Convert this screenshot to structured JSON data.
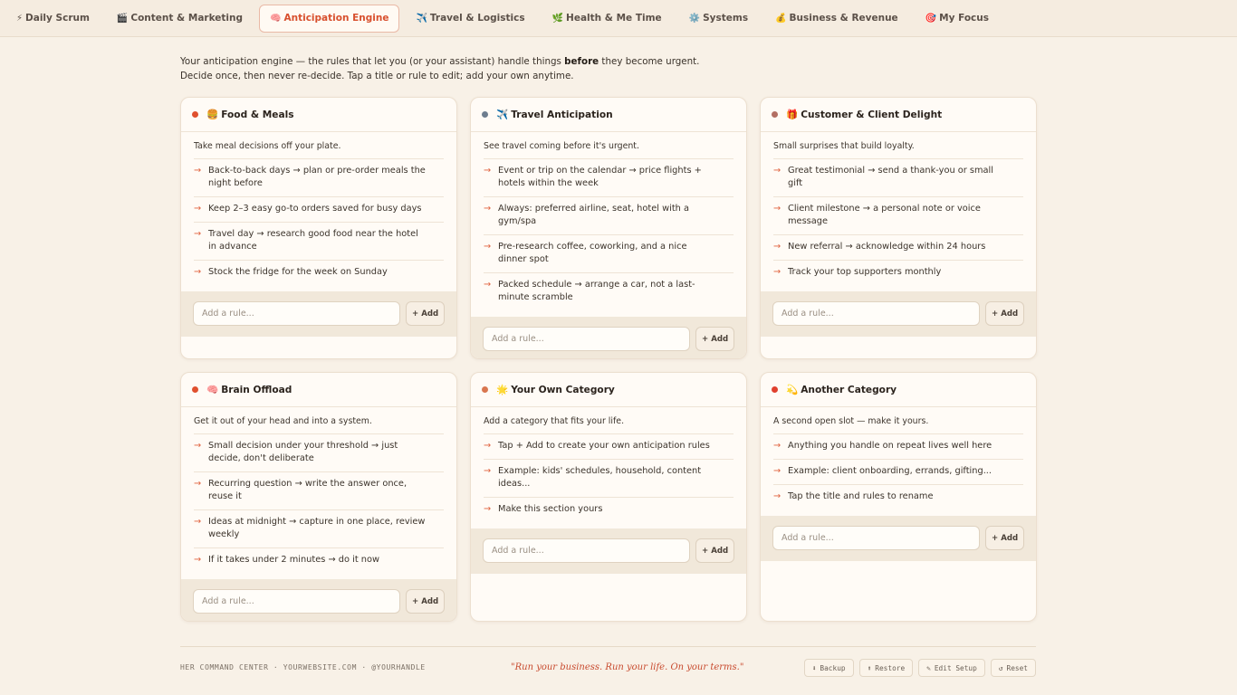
{
  "nav": {
    "tabs": [
      {
        "icon": "⚡",
        "label": "Daily Scrum"
      },
      {
        "icon": "🎬",
        "label": "Content & Marketing"
      },
      {
        "icon": "🧠",
        "label": "Anticipation Engine"
      },
      {
        "icon": "✈️",
        "label": "Travel & Logistics"
      },
      {
        "icon": "🌿",
        "label": "Health & Me Time"
      },
      {
        "icon": "⚙️",
        "label": "Systems"
      },
      {
        "icon": "💰",
        "label": "Business & Revenue"
      },
      {
        "icon": "🎯",
        "label": "My Focus"
      }
    ],
    "active_index": 2
  },
  "intro": {
    "part1": "Your anticipation engine — the rules that let you (or your assistant) handle things ",
    "bold": "before",
    "part2": " they become urgent. Decide once, then never re-decide. Tap a title or rule to edit; add your own anytime."
  },
  "cards": [
    {
      "dot_color": "#e0502e",
      "icon": "🍔",
      "title": "Food & Meals",
      "desc": "Take meal decisions off your plate.",
      "rules": [
        "Back-to-back days → plan or pre-order meals the night before",
        "Keep 2–3 easy go-to orders saved for busy days",
        "Travel day → research good food near the hotel in advance",
        "Stock the fridge for the week on Sunday"
      ],
      "placeholder": "Add a rule...",
      "add_label": "+ Add"
    },
    {
      "dot_color": "#6d7d8f",
      "icon": "✈️",
      "title": "Travel Anticipation",
      "desc": "See travel coming before it's urgent.",
      "rules": [
        "Event or trip on the calendar → price flights + hotels within the week",
        "Always: preferred airline, seat, hotel with a gym/spa",
        "Pre-research coffee, coworking, and a nice dinner spot",
        "Packed schedule → arrange a car, not a last-minute scramble"
      ],
      "placeholder": "Add a rule...",
      "add_label": "+ Add"
    },
    {
      "dot_color": "#b36f64",
      "icon": "🎁",
      "title": "Customer & Client Delight",
      "desc": "Small surprises that build loyalty.",
      "rules": [
        "Great testimonial → send a thank-you or small gift",
        "Client milestone → a personal note or voice message",
        "New referral → acknowledge within 24 hours",
        "Track your top supporters monthly"
      ],
      "placeholder": "Add a rule...",
      "add_label": "+ Add"
    },
    {
      "dot_color": "#e0502e",
      "icon": "🧠",
      "title": "Brain Offload",
      "desc": "Get it out of your head and into a system.",
      "rules": [
        "Small decision under your threshold → just decide, don't deliberate",
        "Recurring question → write the answer once, reuse it",
        "Ideas at midnight → capture in one place, review weekly",
        "If it takes under 2 minutes → do it now"
      ],
      "placeholder": "Add a rule...",
      "add_label": "+ Add"
    },
    {
      "dot_color": "#d9764f",
      "icon": "🌟",
      "title": "Your Own Category",
      "desc": "Add a category that fits your life.",
      "rules": [
        "Tap + Add to create your own anticipation rules",
        "Example: kids' schedules, household, content ideas...",
        "Make this section yours"
      ],
      "placeholder": "Add a rule...",
      "add_label": "+ Add"
    },
    {
      "dot_color": "#e0402e",
      "icon": "💫",
      "title": "Another Category",
      "desc": "A second open slot — make it yours.",
      "rules": [
        "Anything you handle on repeat lives well here",
        "Example: client onboarding, errands, gifting...",
        "Tap the title and rules to rename"
      ],
      "placeholder": "Add a rule...",
      "add_label": "+ Add"
    }
  ],
  "footer": {
    "brand": "HER COMMAND CENTER · YOURWEBSITE.COM · @YOURHANDLE",
    "quote": "\"Run your business. Run your life. On your terms.\"",
    "actions": [
      {
        "icon": "⬇",
        "label": "Backup"
      },
      {
        "icon": "⬆",
        "label": "Restore"
      },
      {
        "icon": "✎",
        "label": "Edit Setup"
      },
      {
        "icon": "↺",
        "label": "Reset"
      }
    ]
  }
}
